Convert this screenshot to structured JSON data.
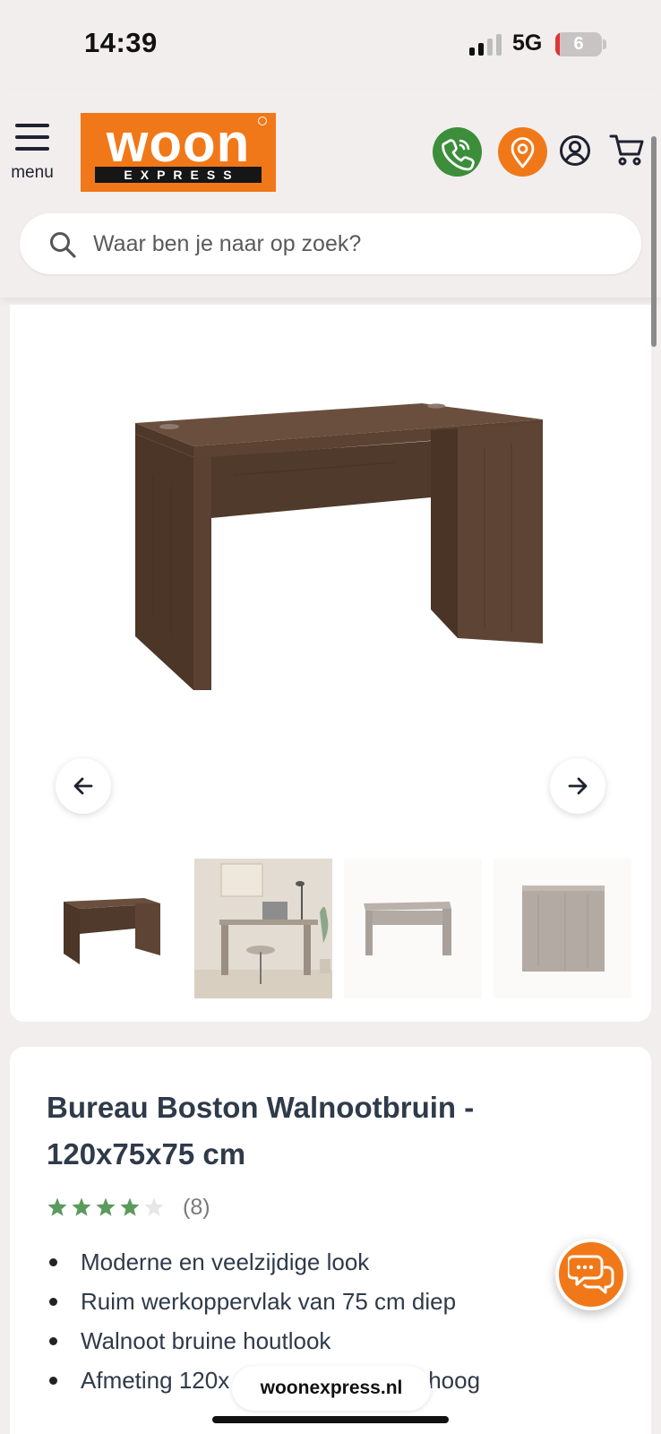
{
  "status_bar": {
    "time": "14:39",
    "network": "5G",
    "battery": "6",
    "battery_level": 0.06
  },
  "header": {
    "menu_label": "menu",
    "logo": {
      "word": "woon",
      "sub": "EXPRESS"
    },
    "icons": [
      "phone-icon",
      "location-pin-icon",
      "user-account-icon",
      "shopping-cart-icon",
      "hamburger-menu-icon"
    ],
    "colors": {
      "brand_orange": "#f07819",
      "phone_green": "#3c8e3a",
      "star_green": "#5a9a5d"
    }
  },
  "search": {
    "placeholder": "Waar ben je naar op zoek?"
  },
  "gallery": {
    "thumbnails": [
      "desk-front",
      "desk-in-room",
      "desk-grey",
      "desk-side"
    ],
    "active_index": 0
  },
  "product": {
    "title": "Bureau Boston Walnootbruin - 120x75x75 cm",
    "rating": 4,
    "rating_max": 5,
    "review_count": "(8)",
    "usps": [
      "Moderne en veelzijdige look",
      "Ruim werkoppervlak van 75 cm diep",
      "Walnoot bruine houtlook",
      "Afmeting  120x",
      "hoog"
    ]
  },
  "browser": {
    "url": "woonexpress.nl"
  }
}
